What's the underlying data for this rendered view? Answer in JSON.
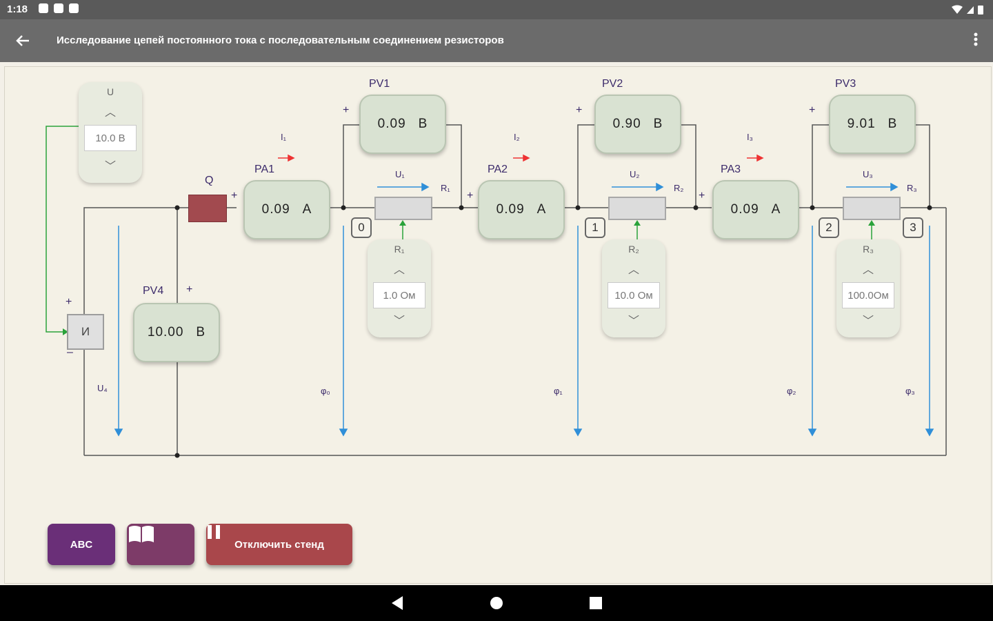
{
  "status": {
    "time": "1:18"
  },
  "appbar": {
    "back_icon": "arrow-left-icon",
    "title": "Исследование цепей постоянного тока с последовательным соединением резисторов",
    "menu_icon": "more-vertical-icon"
  },
  "circuit": {
    "source_label": "И",
    "fuse_label": "Q",
    "plus": "+",
    "minus": "–",
    "u_label": "U₄",
    "voltmeters": [
      {
        "name": "PV1",
        "value": "0.09",
        "unit": "В"
      },
      {
        "name": "PV2",
        "value": "0.90",
        "unit": "В"
      },
      {
        "name": "PV3",
        "value": "9.01",
        "unit": "В"
      },
      {
        "name": "PV4",
        "value": "10.00",
        "unit": "В"
      }
    ],
    "ammeters": [
      {
        "name": "PA1",
        "value": "0.09",
        "unit": "А",
        "current": "I₁"
      },
      {
        "name": "PA2",
        "value": "0.09",
        "unit": "А",
        "current": "I₂"
      },
      {
        "name": "PA3",
        "value": "0.09",
        "unit": "А",
        "current": "I₃"
      }
    ],
    "resistors": [
      {
        "name": "R₁",
        "voltage": "U₁",
        "spinner_value": "1.0  Ом"
      },
      {
        "name": "R₂",
        "voltage": "U₂",
        "spinner_value": "10.0  Ом"
      },
      {
        "name": "R₃",
        "voltage": "U₃",
        "spinner_value": "100.0Ом"
      }
    ],
    "source_spinner": {
      "name": "U",
      "value": "10.0  В"
    },
    "nodes": [
      "0",
      "1",
      "2",
      "3"
    ],
    "potentials": [
      "φ₀",
      "φ₁",
      "φ₂",
      "φ₃"
    ]
  },
  "buttons": {
    "abc_label": "ABC",
    "book_icon": "book-open-icon",
    "stop_label": "Отключить стенд",
    "stop_icon": "pause-icon"
  },
  "navbar": {
    "back_icon": "nav-back-icon",
    "home_icon": "nav-home-icon",
    "recents_icon": "nav-recents-icon"
  },
  "colors": {
    "accent": "#6a2f78",
    "stop": "#a9474b",
    "meter": "#d9e2d2"
  }
}
